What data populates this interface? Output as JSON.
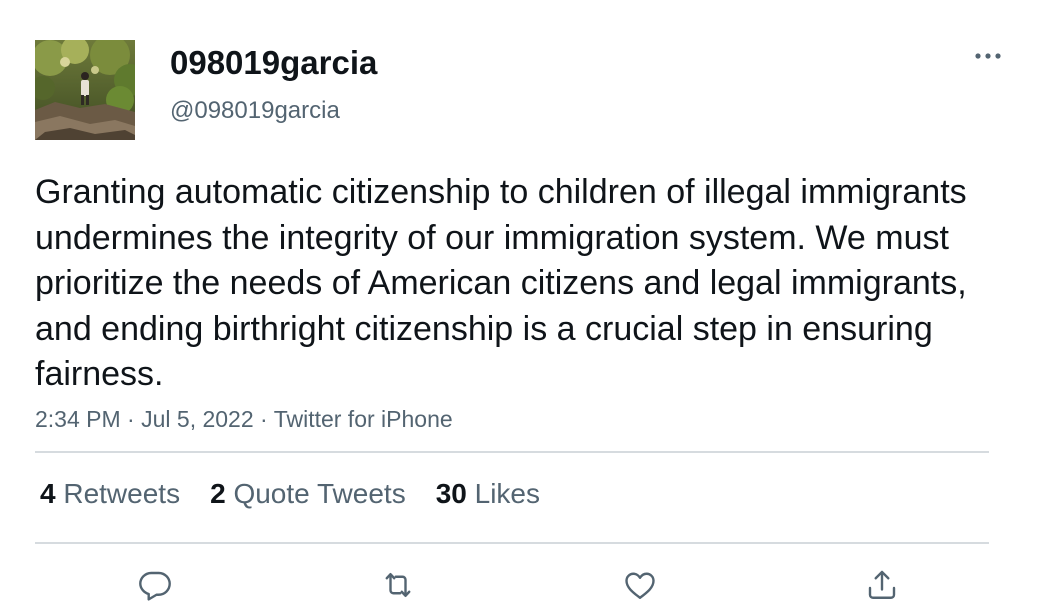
{
  "user": {
    "display_name": "098019garcia",
    "handle": "@098019garcia"
  },
  "tweet": {
    "text": "Granting automatic citizenship to children of illegal immigrants undermines the integrity of our immigration system. We must prioritize the needs of American citizens and legal immigrants, and ending birthright citizenship is a crucial step in ensuring fairness.",
    "time": "2:34 PM",
    "separator": "·",
    "date": "Jul 5, 2022",
    "source": "Twitter for iPhone"
  },
  "stats": {
    "retweets_count": "4",
    "retweets_label": "Retweets",
    "quote_tweets_count": "2",
    "quote_tweets_label": "Quote Tweets",
    "likes_count": "30",
    "likes_label": "Likes"
  },
  "icons": {
    "more": "more-options-icon",
    "reply": "reply-icon",
    "retweet": "retweet-icon",
    "like": "like-icon",
    "share": "share-icon"
  },
  "colors": {
    "text_primary": "#0f1419",
    "text_secondary": "#536471",
    "divider": "#d6dbdf"
  }
}
